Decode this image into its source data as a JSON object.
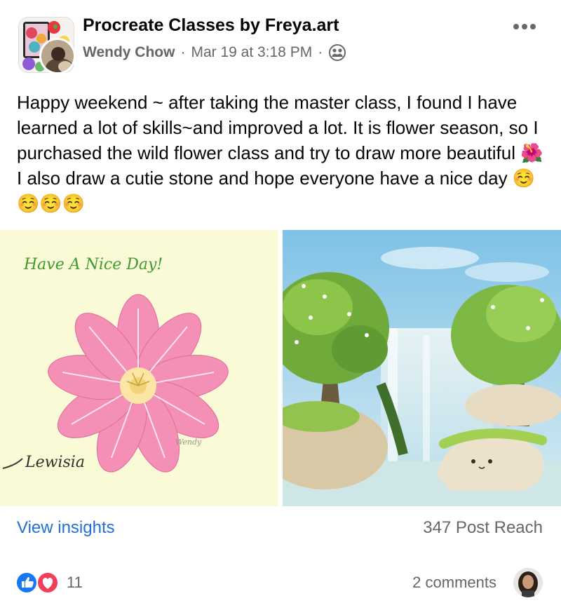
{
  "post": {
    "group_name": "Procreate Classes by Freya.art",
    "author": "Wendy Chow",
    "separator": "·",
    "timestamp": "Mar 19 at 3:18 PM",
    "audience_icon": "members-group-icon",
    "text_part1": "Happy weekend ~ after taking the master class, I found I have learned a lot of skills~and improved a lot. It is flower season, so I purchased the wild flower class and try to draw more beautiful",
    "text_emoji1": "🌺",
    "text_part2": " I also draw a cutie stone and hope everyone have a nice day",
    "text_emoji_end": "☺️☺️☺️☺️"
  },
  "photos": {
    "left": {
      "handwriting": "Have A Nice Day!",
      "flower_caption": "Lewisia",
      "signature": "Wendy"
    },
    "right": {
      "subject": "waterfall-with-stone-drawing"
    }
  },
  "insights": {
    "view_label": "View insights",
    "reach_label": "347 Post Reach"
  },
  "reactions": {
    "icons": [
      "like-icon",
      "love-icon"
    ],
    "count": "11",
    "comments_label": "2 comments"
  },
  "colors": {
    "link_blue": "#216fdb",
    "meta_gray": "#65676b",
    "like_blue": "#1877f2",
    "love_red": "#f33e58",
    "photo_left_bg": "#fbfad7",
    "handwriting_green": "#3f9a2f"
  }
}
